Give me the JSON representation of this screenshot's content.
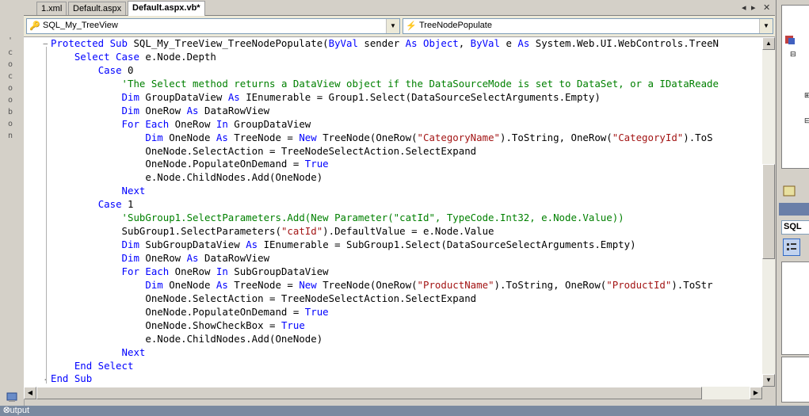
{
  "tabs": [
    {
      "label": "1.xml"
    },
    {
      "label": "Default.aspx"
    },
    {
      "label": "Default.aspx.vb*"
    }
  ],
  "tab_controls": {
    "prev": "◂",
    "next": "▸",
    "close": "✕"
  },
  "navbar": {
    "class_combo": "SQL_My_TreeView",
    "method_combo": "TreeNodePopulate"
  },
  "left_toolbox_vertical_text": "Toolbox",
  "code_lines": [
    [
      [
        "k",
        "Protected Sub "
      ],
      [
        "",
        "SQL_My_TreeView_TreeNodePopulate("
      ],
      [
        "k",
        "ByVal "
      ],
      [
        "",
        "sender "
      ],
      [
        "k",
        "As Object"
      ],
      [
        "",
        " , "
      ],
      [
        "k",
        "ByVal "
      ],
      [
        "",
        "e "
      ],
      [
        "k",
        "As "
      ],
      [
        "",
        "System.Web.UI.WebControls.TreeN"
      ]
    ],
    [
      [
        "",
        "    "
      ],
      [
        "k",
        "Select Case "
      ],
      [
        "",
        "e.Node.Depth"
      ]
    ],
    [
      [
        "",
        "        "
      ],
      [
        "k",
        "Case "
      ],
      [
        "",
        "0"
      ]
    ],
    [
      [
        "",
        "            "
      ],
      [
        "c",
        "'The Select method returns a DataView object if the DataSourceMode is set to DataSet, or a IDataReade"
      ]
    ],
    [
      [
        "",
        "            "
      ],
      [
        "k",
        "Dim "
      ],
      [
        "",
        "GroupDataView "
      ],
      [
        "k",
        "As "
      ],
      [
        "",
        "IEnumerable = Group1.Select(DataSourceSelectArguments.Empty)"
      ]
    ],
    [
      [
        "",
        "            "
      ],
      [
        "k",
        "Dim "
      ],
      [
        "",
        "OneRow "
      ],
      [
        "k",
        "As "
      ],
      [
        "",
        "DataRowView"
      ]
    ],
    [
      [
        "",
        "            "
      ],
      [
        "k",
        "For Each "
      ],
      [
        "",
        "OneRow "
      ],
      [
        "k",
        "In "
      ],
      [
        "",
        "GroupDataView"
      ]
    ],
    [
      [
        "",
        "                "
      ],
      [
        "k",
        "Dim "
      ],
      [
        "",
        "OneNode "
      ],
      [
        "k",
        "As "
      ],
      [
        "",
        "TreeNode = "
      ],
      [
        "k",
        "New "
      ],
      [
        "",
        "TreeNode(OneRow("
      ],
      [
        "s",
        "\"CategoryName\""
      ],
      [
        "",
        ").ToString, OneRow("
      ],
      [
        "s",
        "\"CategoryId\""
      ],
      [
        "",
        ").ToS"
      ]
    ],
    [
      [
        "",
        "                "
      ],
      [
        "",
        "OneNode.SelectAction = TreeNodeSelectAction.SelectExpand"
      ]
    ],
    [
      [
        "",
        "                "
      ],
      [
        "",
        "OneNode.PopulateOnDemand = "
      ],
      [
        "k",
        "True"
      ]
    ],
    [
      [
        "",
        "                "
      ],
      [
        "",
        "e.Node.ChildNodes.Add(OneNode)"
      ]
    ],
    [
      [
        "",
        "            "
      ],
      [
        "k",
        "Next"
      ]
    ],
    [
      [
        "",
        "        "
      ],
      [
        "k",
        "Case "
      ],
      [
        "",
        "1"
      ]
    ],
    [
      [
        "",
        "            "
      ],
      [
        "c",
        "'SubGroup1.SelectParameters.Add(New Parameter(\"catId\", TypeCode.Int32, e.Node.Value))"
      ]
    ],
    [
      [
        "",
        "            "
      ],
      [
        "",
        "SubGroup1.SelectParameters("
      ],
      [
        "s",
        "\"catId\""
      ],
      [
        "",
        ").DefaultValue = e.Node.Value"
      ]
    ],
    [
      [
        "",
        "            "
      ],
      [
        "k",
        "Dim "
      ],
      [
        "",
        "SubGroupDataView "
      ],
      [
        "k",
        "As "
      ],
      [
        "",
        "IEnumerable = SubGroup1.Select(DataSourceSelectArguments.Empty)"
      ]
    ],
    [
      [
        "",
        "            "
      ],
      [
        "k",
        "Dim "
      ],
      [
        "",
        "OneRow "
      ],
      [
        "k",
        "As "
      ],
      [
        "",
        "DataRowView"
      ]
    ],
    [
      [
        "",
        "            "
      ],
      [
        "k",
        "For Each "
      ],
      [
        "",
        "OneRow "
      ],
      [
        "k",
        "In "
      ],
      [
        "",
        "SubGroupDataView"
      ]
    ],
    [
      [
        "",
        "                "
      ],
      [
        "k",
        "Dim "
      ],
      [
        "",
        "OneNode "
      ],
      [
        "k",
        "As "
      ],
      [
        "",
        "TreeNode = "
      ],
      [
        "k",
        "New "
      ],
      [
        "",
        "TreeNode(OneRow("
      ],
      [
        "s",
        "\"ProductName\""
      ],
      [
        "",
        ").ToString, OneRow("
      ],
      [
        "s",
        "\"ProductId\""
      ],
      [
        "",
        ").ToStr"
      ]
    ],
    [
      [
        "",
        "                "
      ],
      [
        "",
        "OneNode.SelectAction = TreeNodeSelectAction.SelectExpand"
      ]
    ],
    [
      [
        "",
        "                "
      ],
      [
        "",
        "OneNode.PopulateOnDemand = "
      ],
      [
        "k",
        "True"
      ]
    ],
    [
      [
        "",
        "                "
      ],
      [
        "",
        "OneNode.ShowCheckBox = "
      ],
      [
        "k",
        "True"
      ]
    ],
    [
      [
        "",
        "                "
      ],
      [
        "",
        "e.Node.ChildNodes.Add(OneNode)"
      ]
    ],
    [
      [
        "",
        "            "
      ],
      [
        "k",
        "Next"
      ]
    ],
    [
      [
        "",
        "    "
      ],
      [
        "k",
        "End Select"
      ]
    ],
    [
      [
        "k",
        "End Sub"
      ]
    ]
  ],
  "right_panel": {
    "combo_label": "SQL"
  },
  "output_title": "Output",
  "output_close": "✕",
  "colors": {
    "keyword": "#0000ff",
    "string": "#a31515",
    "comment": "#008000"
  }
}
